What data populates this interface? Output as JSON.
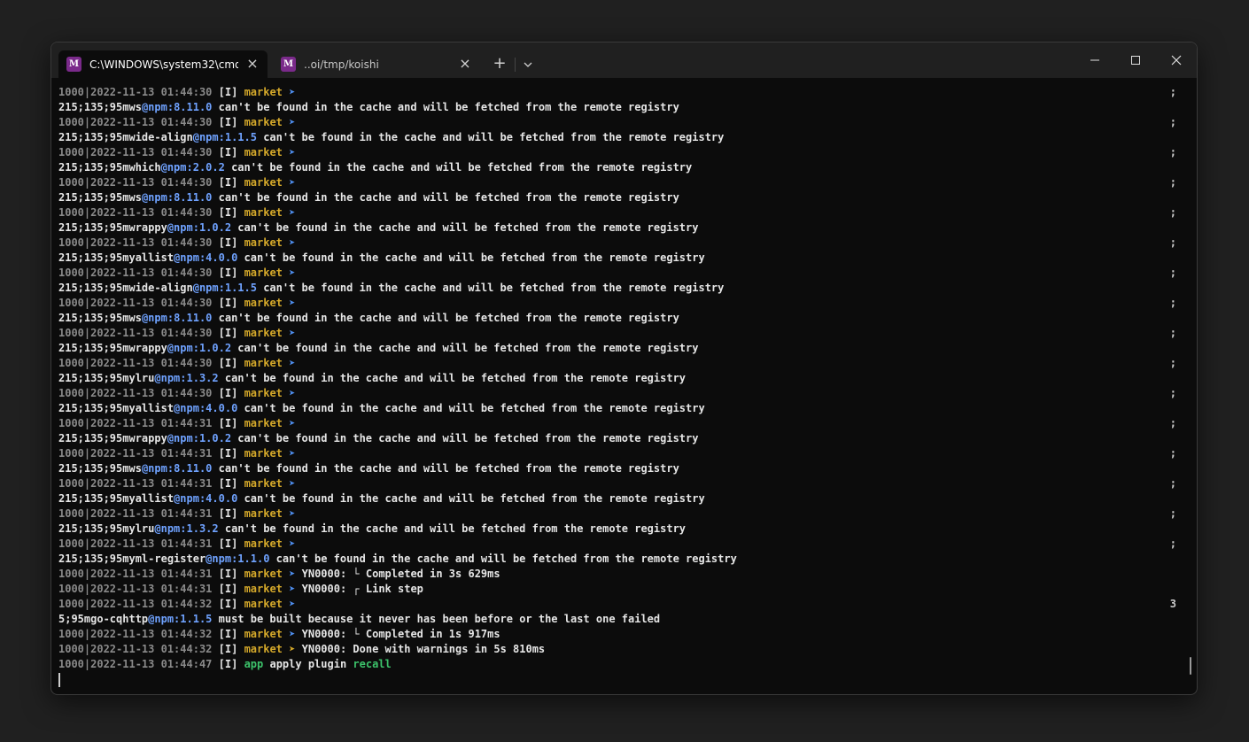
{
  "window": {
    "tabs": [
      {
        "title": "C:\\WINDOWS\\system32\\cmd.",
        "icon": "terminal-app-icon",
        "active": true
      },
      {
        "title": "..oi/tmp/koishi",
        "icon": "terminal-app-icon",
        "active": false
      }
    ],
    "icon_glyph": "M",
    "new_tab_label": "+",
    "close_tab_glyph": "×"
  },
  "colors": {
    "terminal_bg": "#0c0c0c",
    "titlebar": "#202020",
    "tag_yellow": "#d4a82a",
    "pkg_blue": "#6fa2ff",
    "arrow_blue": "#4f8ff0",
    "green": "#3cc26a"
  },
  "lines": [
    {
      "kind": "log",
      "ts": "2022-11-13 01:44:30",
      "right": ";"
    },
    {
      "kind": "pkg",
      "pkg": "mws",
      "ver": "8.11.0"
    },
    {
      "kind": "log",
      "ts": "2022-11-13 01:44:30",
      "right": ";"
    },
    {
      "kind": "pkg",
      "pkg": "mwide-align",
      "ver": "1.1.5"
    },
    {
      "kind": "log",
      "ts": "2022-11-13 01:44:30",
      "right": ";"
    },
    {
      "kind": "pkg",
      "pkg": "mwhich",
      "ver": "2.0.2"
    },
    {
      "kind": "log",
      "ts": "2022-11-13 01:44:30",
      "right": ";"
    },
    {
      "kind": "pkg",
      "pkg": "mws",
      "ver": "8.11.0"
    },
    {
      "kind": "log",
      "ts": "2022-11-13 01:44:30",
      "right": ";"
    },
    {
      "kind": "pkg",
      "pkg": "mwrappy",
      "ver": "1.0.2"
    },
    {
      "kind": "log",
      "ts": "2022-11-13 01:44:30",
      "right": ";"
    },
    {
      "kind": "pkg",
      "pkg": "myallist",
      "ver": "4.0.0"
    },
    {
      "kind": "log",
      "ts": "2022-11-13 01:44:30",
      "right": ";"
    },
    {
      "kind": "pkg",
      "pkg": "mwide-align",
      "ver": "1.1.5"
    },
    {
      "kind": "log",
      "ts": "2022-11-13 01:44:30",
      "right": ";"
    },
    {
      "kind": "pkg",
      "pkg": "mws",
      "ver": "8.11.0"
    },
    {
      "kind": "log",
      "ts": "2022-11-13 01:44:30",
      "right": ";"
    },
    {
      "kind": "pkg",
      "pkg": "mwrappy",
      "ver": "1.0.2"
    },
    {
      "kind": "log",
      "ts": "2022-11-13 01:44:30",
      "right": ";"
    },
    {
      "kind": "pkg",
      "pkg": "mylru",
      "ver": "1.3.2"
    },
    {
      "kind": "log",
      "ts": "2022-11-13 01:44:30",
      "right": ";"
    },
    {
      "kind": "pkg",
      "pkg": "myallist",
      "ver": "4.0.0"
    },
    {
      "kind": "log",
      "ts": "2022-11-13 01:44:31",
      "right": ";"
    },
    {
      "kind": "pkg",
      "pkg": "mwrappy",
      "ver": "1.0.2"
    },
    {
      "kind": "log",
      "ts": "2022-11-13 01:44:31",
      "right": ";"
    },
    {
      "kind": "pkg",
      "pkg": "mws",
      "ver": "8.11.0"
    },
    {
      "kind": "log",
      "ts": "2022-11-13 01:44:31",
      "right": ";"
    },
    {
      "kind": "pkg",
      "pkg": "myallist",
      "ver": "4.0.0"
    },
    {
      "kind": "log",
      "ts": "2022-11-13 01:44:31",
      "right": ";"
    },
    {
      "kind": "pkg",
      "pkg": "mylru",
      "ver": "1.3.2"
    },
    {
      "kind": "log",
      "ts": "2022-11-13 01:44:31",
      "right": ";"
    },
    {
      "kind": "pkg",
      "pkg": "myml-register",
      "ver": "1.1.0"
    },
    {
      "kind": "log",
      "ts": "2022-11-13 01:44:31",
      "msg": "YN0000: └ Completed in 3s 629ms"
    },
    {
      "kind": "log",
      "ts": "2022-11-13 01:44:31",
      "msg": "YN0000: ┌ Link step"
    },
    {
      "kind": "log",
      "ts": "2022-11-13 01:44:32",
      "right": "3"
    },
    {
      "kind": "build",
      "prefix": "5;95m",
      "pkg": "go-cqhttp",
      "ver": "1.1.5",
      "rest": " must be built because it never has been before or the last one failed"
    },
    {
      "kind": "log",
      "ts": "2022-11-13 01:44:32",
      "msg": "YN0000: └ Completed in 1s 917ms"
    },
    {
      "kind": "log",
      "ts": "2022-11-13 01:44:32",
      "msg": "YN0000: Done with warnings in 5s 810ms",
      "arrow": "➤",
      "arrowYellow": true
    },
    {
      "kind": "app",
      "ts": "2022-11-13 01:44:47",
      "app": "app",
      "msg": " apply plugin ",
      "plugin": "recall"
    }
  ],
  "text": {
    "pid": "1000|",
    "level": "[I]",
    "market": "market",
    "arrow": "➤",
    "pkg_prefix": "215;135;95",
    "at_npm": "@npm:",
    "fetch_msg": " can't be found in the cache and will be fetched from the remote registry"
  }
}
